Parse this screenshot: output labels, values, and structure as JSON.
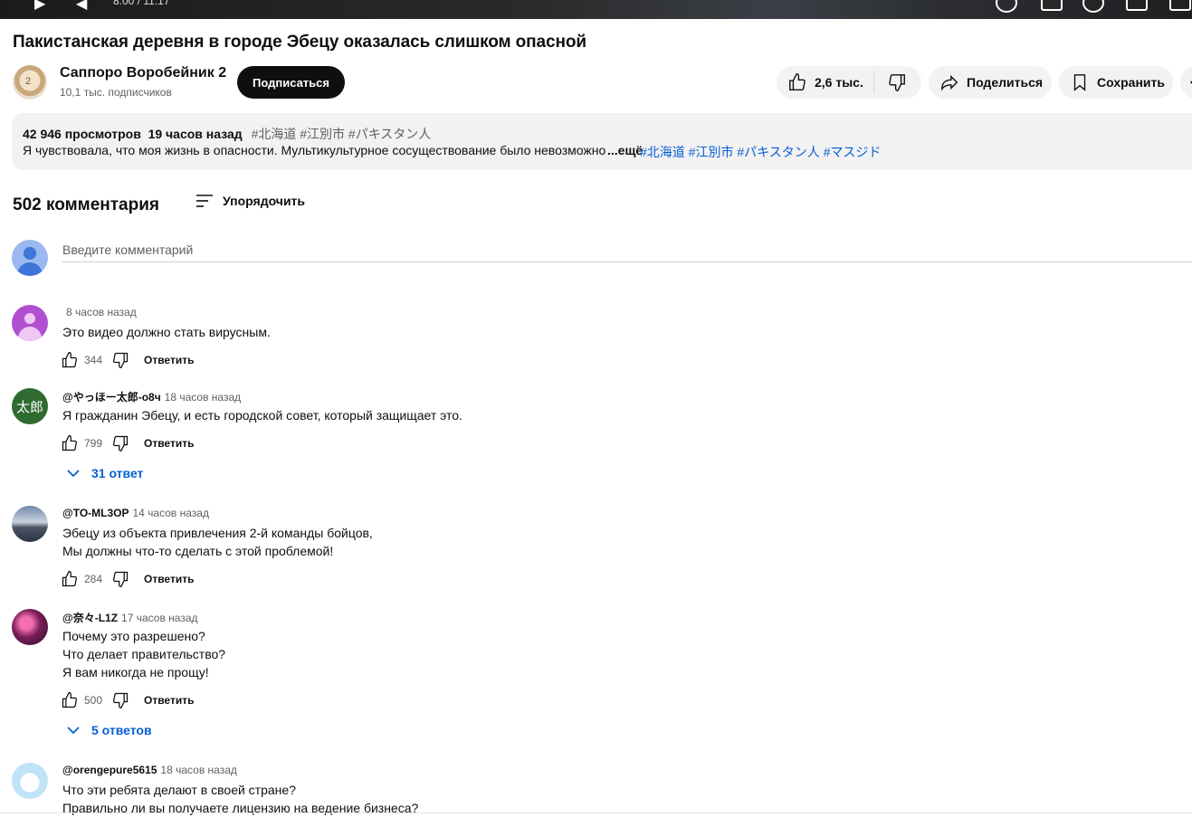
{
  "player": {
    "time": "8:00 / 11:17"
  },
  "video": {
    "title": "Пакистанская деревня в городе Эбецу оказалась слишком опасной",
    "channel_name": "Саппоро Воробейник 2",
    "subscribers": "10,1 тыс. подписчиков",
    "subscribe_label": "Подписаться",
    "likes": "2,6 тыс.",
    "share_label": "Поделиться",
    "save_label": "Сохранить"
  },
  "description": {
    "views": "42 946 просмотров",
    "age": "19 часов назад",
    "tags": "#北海道 #江別市 #パキスタン人",
    "text": "Я чувствовала, что моя жизнь в опасности. Мультикультурное сосуществование было невозможно",
    "more_label": "...ещё",
    "links": "#北海道 #江別市 #パキスタン人 #マスジド"
  },
  "comments_section": {
    "count": "502 комментария",
    "sort_label": "Упорядочить",
    "input_placeholder": "Введите комментарий",
    "reply_label": "Ответить",
    "comments": [
      {
        "author": "",
        "time": "8 часов назад",
        "lines": [
          "Это видео должно стать вирусным."
        ],
        "likes": "344"
      },
      {
        "author": "@やっほー太郎-o8ч",
        "time": "18 часов назад",
        "lines": [
          "Я гражданин Эбецу, и есть городской совет, который защищает это."
        ],
        "likes": "799",
        "replies": "31 ответ",
        "avatar_text": "太郎"
      },
      {
        "author": "@TO-ML3OP",
        "time": "14 часов назад",
        "lines": [
          "Эбецу из объекта привлечения 2-й команды бойцов,",
          "Мы должны что-то сделать с этой проблемой!"
        ],
        "likes": "284"
      },
      {
        "author": "@奈々-L1Z",
        "time": "17 часов назад",
        "lines": [
          "Почему это разрешено?",
          "Что делает правительство?",
          "Я вам никогда не прощу!"
        ],
        "likes": "500",
        "replies": "5 ответов"
      },
      {
        "author": "@orengepure5615",
        "time": "18 часов назад",
        "lines": [
          "Что эти ребята делают в своей стране?",
          "Правильно ли вы получаете лицензию на ведение бизнеса?"
        ]
      }
    ]
  },
  "colors": {
    "link": "#065fd4",
    "subscribe_bg": "#0f0f0f",
    "pill_bg": "#f2f2f2"
  }
}
